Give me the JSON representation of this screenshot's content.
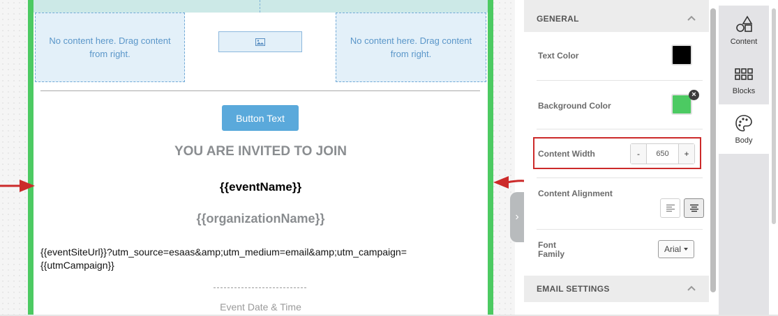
{
  "canvas": {
    "dropzone_left_text": "No content here. Drag content from right.",
    "dropzone_right_text": "No content here. Drag content from right.",
    "button_text": "Button Text",
    "heading_invited": "YOU ARE INVITED TO JOIN",
    "event_name": "{{eventName}}",
    "organization_name": "{{organizationName}}",
    "site_url": "{{eventSiteUrl}}?utm_source=esaas&amp;utm_medium=email&amp;utm_campaign={{utmCampaign}}",
    "event_date_label": "Event Date & Time",
    "border_color": "#4cca62"
  },
  "settings": {
    "general_header": "GENERAL",
    "text_color_label": "Text Color",
    "text_color_value": "#000000",
    "background_color_label": "Background Color",
    "background_color_value": "#4cca62",
    "content_width_label": "Content Width",
    "content_width_value": "650",
    "stepper_minus": "-",
    "stepper_plus": "+",
    "content_alignment_label": "Content Alignment",
    "alignment_selected": "center",
    "font_family_label": "Font Family",
    "font_family_value": "Arial",
    "email_settings_header": "EMAIL SETTINGS",
    "remove_glyph": "×"
  },
  "tabs": [
    {
      "label": "Content",
      "icon": "shapes-icon"
    },
    {
      "label": "Blocks",
      "icon": "grid-icon"
    },
    {
      "label": "Body",
      "icon": "palette-icon",
      "active": true
    }
  ],
  "annotation_color": "#cc2a2a"
}
